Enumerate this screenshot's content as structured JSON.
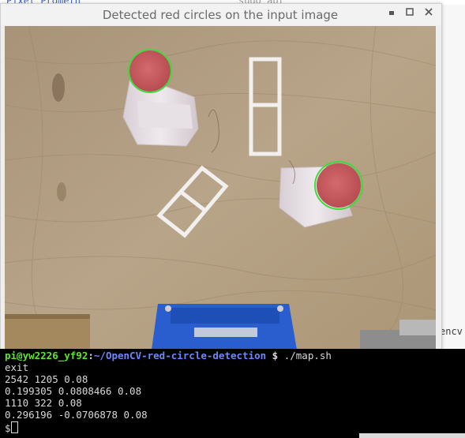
{
  "background": {
    "top_left_text": "Pixel Prometh",
    "top_mid_text": "sudo apt",
    "right_edge_text": "encv"
  },
  "window": {
    "title": "Detected red circles on the input image",
    "controls": {
      "minimize": "▪",
      "maximize": "▫",
      "close": "✕"
    }
  },
  "image": {
    "description_colors": {
      "wood": "#b39f84",
      "cap_red": "#c75a5e",
      "circle_outline": "#3ddc3d",
      "blue_object": "#2a5ecf"
    },
    "detected_circles_count": 2
  },
  "terminal": {
    "prompt_user": "pi@yw2226_yf92",
    "prompt_sep": ":",
    "prompt_path": "~/OpenCV-red-circle-detection",
    "prompt_symbol": " $ ",
    "command": "./map.sh",
    "lines": [
      "exit",
      "2542 1205 0.08",
      "0.199305 0.0808466 0.08",
      "1110 322 0.08",
      "0.296196 -0.0706878 0.08"
    ],
    "last_prompt": "$"
  }
}
